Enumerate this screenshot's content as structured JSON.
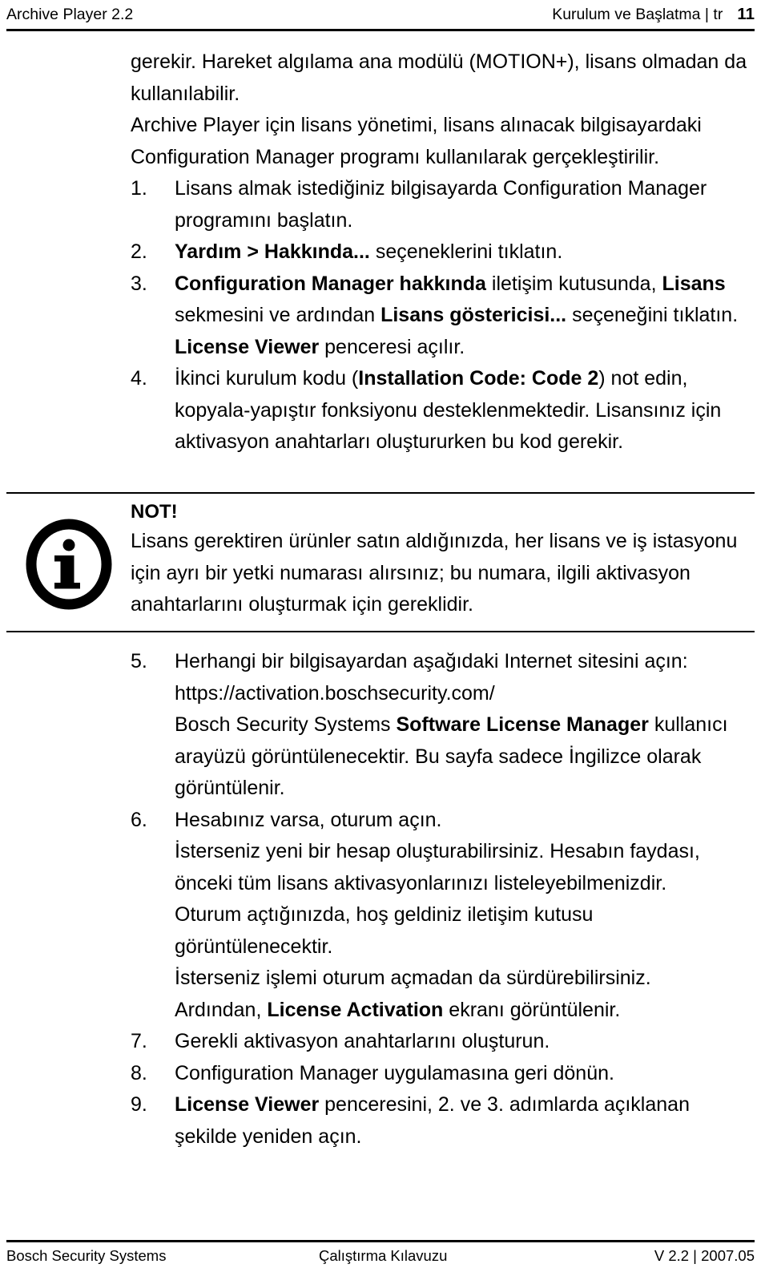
{
  "header": {
    "left": "Archive Player 2.2",
    "right": "Kurulum ve Başlatma | tr",
    "page_number": "11"
  },
  "body": {
    "lead_paragraphs": [
      "gerekir. Hareket algılama ana modülü (MOTION+), lisans olmadan da kullanılabilir.",
      "Archive Player için lisans yönetimi, lisans alınacak bilgisayardaki Configuration Manager programı kullanılarak gerçekleştirilir."
    ],
    "steps_part1": [
      {
        "num": "1.",
        "lines": [
          {
            "runs": [
              {
                "t": "Lisans almak istediğiniz bilgisayarda Configuration Manager programını başlatın.",
                "b": false
              }
            ]
          }
        ]
      },
      {
        "num": "2.",
        "lines": [
          {
            "runs": [
              {
                "t": "Yardım > Hakkında...",
                "b": true
              },
              {
                "t": " seçeneklerini tıklatın.",
                "b": false
              }
            ]
          }
        ]
      },
      {
        "num": "3.",
        "lines": [
          {
            "runs": [
              {
                "t": "Configuration Manager hakkında",
                "b": true
              },
              {
                "t": " iletişim kutusunda, ",
                "b": false
              },
              {
                "t": "Lisans",
                "b": true
              },
              {
                "t": " sekmesini ve ardından ",
                "b": false
              },
              {
                "t": "Lisans göstericisi...",
                "b": true
              },
              {
                "t": " seçeneğini tıklatın.",
                "b": false
              }
            ]
          },
          {
            "runs": [
              {
                "t": "License Viewer",
                "b": true
              },
              {
                "t": " penceresi açılır.",
                "b": false
              }
            ]
          }
        ]
      },
      {
        "num": "4.",
        "lines": [
          {
            "runs": [
              {
                "t": "İkinci kurulum kodu (",
                "b": false
              },
              {
                "t": "Installation Code: Code 2",
                "b": true
              },
              {
                "t": ") not edin, kopyala-yapıştır fonksiyonu desteklenmektedir. Lisansınız için aktivasyon anahtarları oluştururken bu kod gerekir.",
                "b": false
              }
            ]
          }
        ]
      }
    ],
    "note": {
      "icon": "info-icon",
      "title": "NOT!",
      "text": "Lisans gerektiren ürünler satın aldığınızda, her lisans ve iş istasyonu için ayrı bir yetki numarası alırsınız; bu numara, ilgili aktivasyon anahtarlarını oluşturmak için gereklidir."
    },
    "steps_part2": [
      {
        "num": "5.",
        "lines": [
          {
            "runs": [
              {
                "t": "Herhangi bir bilgisayardan aşağıdaki Internet sitesini açın:",
                "b": false
              }
            ]
          },
          {
            "runs": [
              {
                "t": "https://activation.boschsecurity.com/",
                "b": false
              }
            ]
          },
          {
            "runs": [
              {
                "t": "Bosch Security Systems ",
                "b": false
              },
              {
                "t": "Software License Manager",
                "b": true
              },
              {
                "t": " kullanıcı arayüzü görüntülenecektir. Bu sayfa sadece İngilizce olarak görüntülenir.",
                "b": false
              }
            ]
          }
        ]
      },
      {
        "num": "6.",
        "lines": [
          {
            "runs": [
              {
                "t": "Hesabınız varsa, oturum açın.",
                "b": false
              }
            ]
          },
          {
            "runs": [
              {
                "t": "İsterseniz yeni bir hesap oluşturabilirsiniz. Hesabın faydası, önceki tüm lisans aktivasyonlarınızı listeleyebilmenizdir.",
                "b": false
              }
            ]
          },
          {
            "runs": [
              {
                "t": "Oturum açtığınızda, hoş geldiniz iletişim kutusu görüntülenecektir.",
                "b": false
              }
            ]
          },
          {
            "runs": [
              {
                "t": "İsterseniz işlemi oturum açmadan da sürdürebilirsiniz.",
                "b": false
              }
            ]
          },
          {
            "runs": [
              {
                "t": "Ardından, ",
                "b": false
              },
              {
                "t": "License Activation",
                "b": true
              },
              {
                "t": " ekranı görüntülenir.",
                "b": false
              }
            ]
          }
        ]
      },
      {
        "num": "7.",
        "lines": [
          {
            "runs": [
              {
                "t": "Gerekli aktivasyon anahtarlarını oluşturun.",
                "b": false
              }
            ]
          }
        ]
      },
      {
        "num": "8.",
        "lines": [
          {
            "runs": [
              {
                "t": "Configuration Manager uygulamasına geri dönün.",
                "b": false
              }
            ]
          }
        ]
      },
      {
        "num": "9.",
        "lines": [
          {
            "runs": [
              {
                "t": "License Viewer",
                "b": true
              },
              {
                "t": " penceresini, 2. ve 3. adımlarda açıklanan şekilde yeniden açın.",
                "b": false
              }
            ]
          }
        ]
      }
    ]
  },
  "footer": {
    "left": "Bosch Security Systems",
    "middle": "Çalıştırma Kılavuzu",
    "right": "V 2.2 | 2007.05"
  }
}
